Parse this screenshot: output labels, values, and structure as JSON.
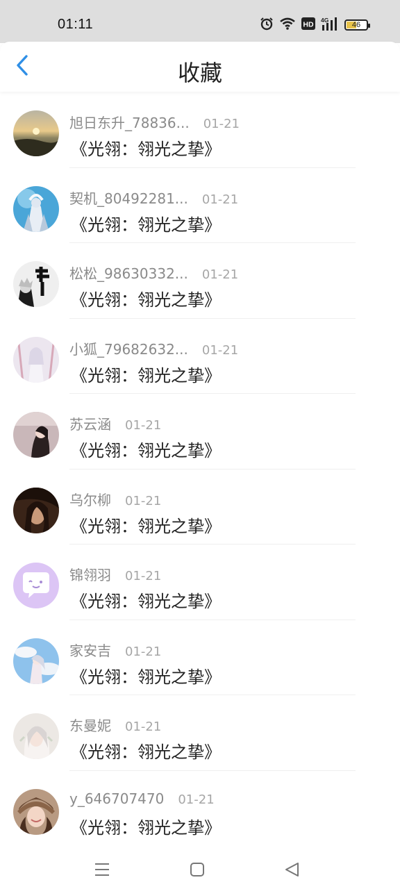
{
  "status": {
    "time": "01:11",
    "icons": [
      "alarm-icon",
      "wifi-icon",
      "hd-icon",
      "signal-4g-icon",
      "battery-icon"
    ],
    "hd_label": "HD",
    "network_label": "4G",
    "battery_level": "46"
  },
  "header": {
    "title": "收藏",
    "back_icon": "chevron-left-icon",
    "accent_color": "#2f8fe6"
  },
  "items": [
    {
      "name": "旭日东升_78836...",
      "date": "01-21",
      "title": "《光翎：翎光之挚》",
      "avatar": "sunrise-photo"
    },
    {
      "name": "契机_80492281...",
      "date": "01-21",
      "title": "《光翎：翎光之挚》",
      "avatar": "anime-white-hair"
    },
    {
      "name": "松松_98630332...",
      "date": "01-21",
      "title": "《光翎：翎光之挚》",
      "avatar": "anime-boy-calligraphy"
    },
    {
      "name": "小狐_79682632...",
      "date": "01-21",
      "title": "《光翎：翎光之挚》",
      "avatar": "anime-girl-white"
    },
    {
      "name": "苏云涵",
      "date": "01-21",
      "title": "《光翎：翎光之挚》",
      "avatar": "girl-photo"
    },
    {
      "name": "乌尔柳",
      "date": "01-21",
      "title": "《光翎：翎光之挚》",
      "avatar": "girl-side-photo"
    },
    {
      "name": "锦翎羽",
      "date": "01-21",
      "title": "《光翎：翎光之挚》",
      "avatar": "default-chat-avatar"
    },
    {
      "name": "家安吉",
      "date": "01-21",
      "title": "《光翎：翎光之挚》",
      "avatar": "anime-sky"
    },
    {
      "name": "东曼妮",
      "date": "01-21",
      "title": "《光翎：翎光之挚》",
      "avatar": "anime-pale"
    },
    {
      "name": "y_646707470",
      "date": "01-21",
      "title": "《光翎：翎光之挚》",
      "avatar": "girl-hat-photo"
    }
  ],
  "navbar": {
    "icons": [
      "menu-icon",
      "home-square-icon",
      "back-triangle-icon"
    ]
  }
}
